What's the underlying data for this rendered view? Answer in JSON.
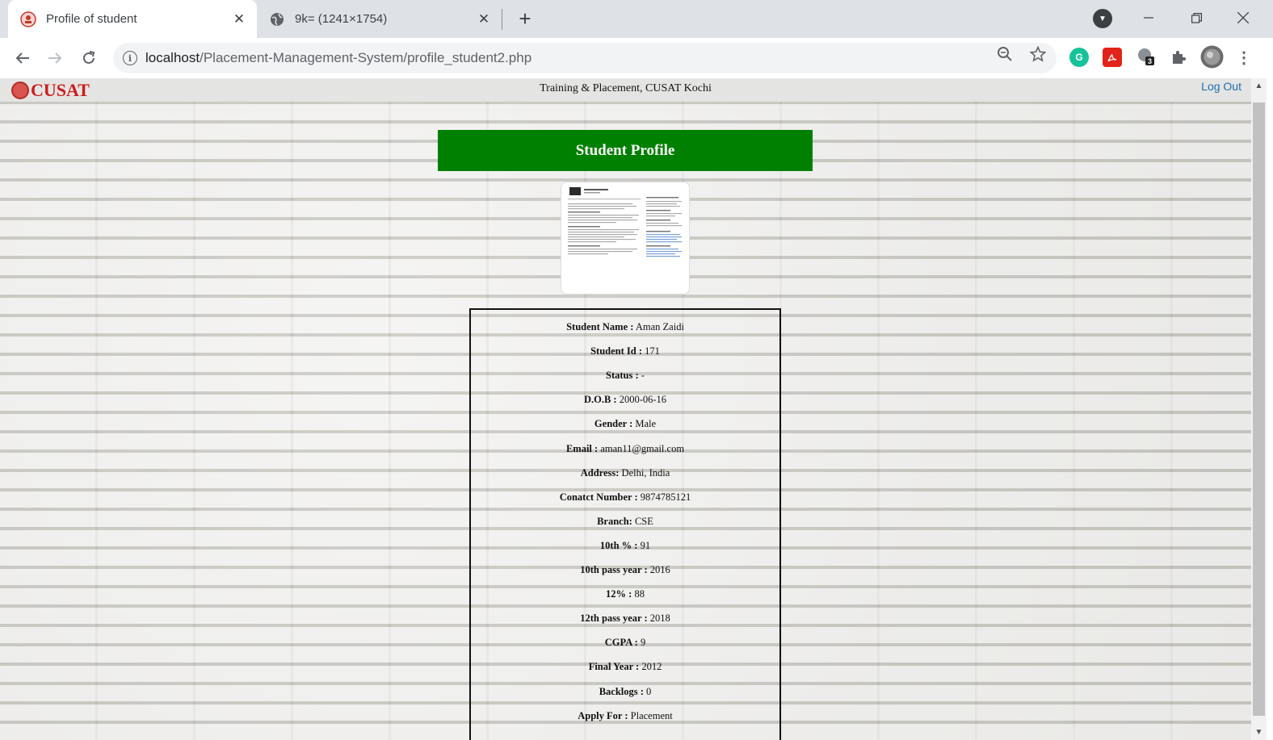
{
  "browser": {
    "tabs": [
      {
        "title": "Profile of student",
        "active": true
      },
      {
        "title": "9k= (1241×1754)",
        "active": false
      }
    ],
    "url_host": "localhost",
    "url_path": "/Placement-Management-System/profile_student2.php",
    "extension_badge": "3"
  },
  "site": {
    "logo_text": "CUSAT",
    "title": "Training & Placement, CUSAT Kochi",
    "logout": "Log Out"
  },
  "profile": {
    "header": "Student Profile",
    "fields": [
      {
        "label": "Student Name :",
        "value": "Aman Zaidi"
      },
      {
        "label": "Student Id :",
        "value": "171"
      },
      {
        "label": "Status :",
        "value": "-"
      },
      {
        "label": "D.O.B :",
        "value": "2000-06-16"
      },
      {
        "label": "Gender :",
        "value": "Male"
      },
      {
        "label": "Email :",
        "value": "aman11@gmail.com"
      },
      {
        "label": "Address:",
        "value": "Delhi, India"
      },
      {
        "label": "Conatct Number :",
        "value": "9874785121"
      },
      {
        "label": "Branch:",
        "value": "CSE"
      },
      {
        "label": "10th % :",
        "value": "91"
      },
      {
        "label": "10th pass year :",
        "value": "2016"
      },
      {
        "label": "12% :",
        "value": "88"
      },
      {
        "label": "12th pass year :",
        "value": "2018"
      },
      {
        "label": "CGPA :",
        "value": "9"
      },
      {
        "label": "Final Year :",
        "value": "2012"
      },
      {
        "label": "Backlogs :",
        "value": "0"
      },
      {
        "label": "Apply For :",
        "value": "Placement"
      }
    ]
  },
  "colors": {
    "header_green": "#008000",
    "link_blue": "#1a6fb5",
    "logo_red": "#cc1b1b"
  }
}
